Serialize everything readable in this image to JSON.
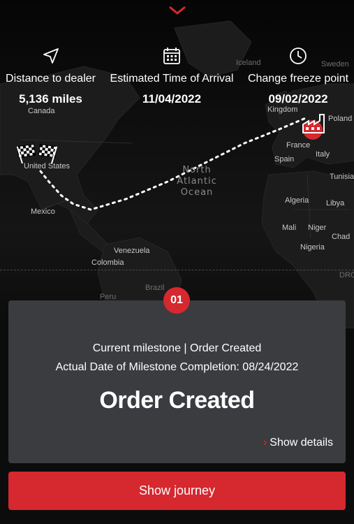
{
  "header": {
    "collapse_icon": "chevron-down-icon",
    "accent": "#d5282f"
  },
  "stats": [
    {
      "icon": "navigation-arrow-icon",
      "label": "Distance to dealer",
      "value": "5,136 miles"
    },
    {
      "icon": "calendar-icon",
      "label": "Estimated Time of Arrival",
      "value": "11/04/2022"
    },
    {
      "icon": "clock-icon",
      "label": "Change freeze point",
      "value": "09/02/2022"
    }
  ],
  "map": {
    "ocean_label": [
      "North",
      "Atlantic",
      "Ocean"
    ],
    "places": [
      {
        "name": "Iceland",
        "dim": true
      },
      {
        "name": "Sweden",
        "dim": true
      },
      {
        "name": "Kingdom",
        "dim": false
      },
      {
        "name": "Poland",
        "dim": false
      },
      {
        "name": "France",
        "dim": false
      },
      {
        "name": "Italy",
        "dim": false
      },
      {
        "name": "Spain",
        "dim": false
      },
      {
        "name": "Canada",
        "dim": false
      },
      {
        "name": "United States",
        "dim": false
      },
      {
        "name": "Mexico",
        "dim": false
      },
      {
        "name": "Algeria",
        "dim": false
      },
      {
        "name": "Libya",
        "dim": false
      },
      {
        "name": "Mali",
        "dim": false
      },
      {
        "name": "Niger",
        "dim": false
      },
      {
        "name": "Chad",
        "dim": false
      },
      {
        "name": "Nigeria",
        "dim": false
      },
      {
        "name": "Venezuela",
        "dim": false
      },
      {
        "name": "Colombia",
        "dim": false
      },
      {
        "name": "Peru",
        "dim": true
      },
      {
        "name": "Brazil",
        "dim": true
      },
      {
        "name": "DRC",
        "dim": true
      },
      {
        "name": "Tunisia",
        "dim": false
      }
    ],
    "origin_icon": "factory-icon",
    "destination_icon": "checkered-flags-icon"
  },
  "milestone": {
    "number": "01",
    "current_line": "Current milestone | Order Created",
    "completion_line": "Actual Date of Milestone Completion: 08/24/2022",
    "title": "Order Created",
    "details_label": "Show details"
  },
  "journey_button": "Show journey"
}
